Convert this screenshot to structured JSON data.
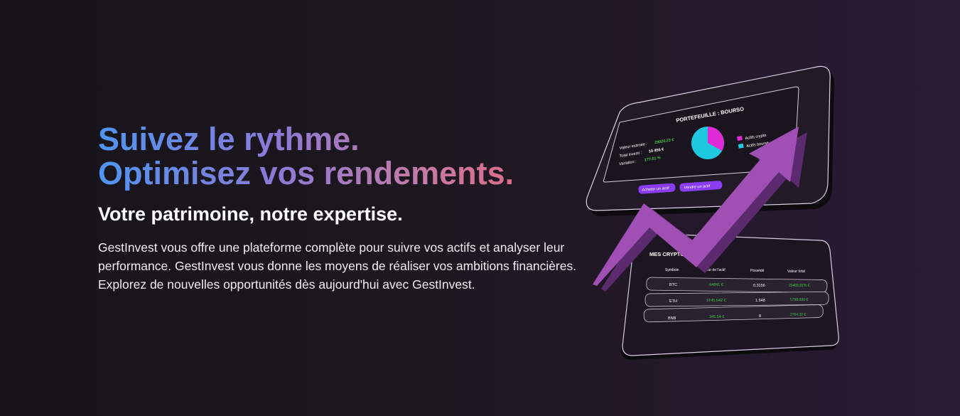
{
  "hero": {
    "headline_line1": "Suivez le rythme.",
    "headline_line2": "Optimisez vos rendements.",
    "subheading": "Votre patrimoine, notre expertise.",
    "description": "GestInvest vous offre une plateforme complète pour suivre vos actifs et analyser leur performance. GestInvest vous donne les moyens de réaliser vos ambitions financières. Explorez de nouvelles opportunités dès aujourd'hui avec GestInvest."
  },
  "portfolio_card": {
    "title": "PORTEFEUILLE : BOURSO",
    "estimated_label": "Valeur estimée :",
    "estimated_value": "29026.23 €",
    "invested_label": "Total investi :",
    "invested_value": "10 456 €",
    "variation_label": "Variation :",
    "variation_value": "177.61 %",
    "legend": [
      "Actifs crypto",
      "Actifs bourse"
    ],
    "buy_button": "Acheter un actif",
    "sell_button": "Vendre un actif",
    "colors": {
      "crypto": "#e02ad8",
      "bourse": "#1ec8e0",
      "green": "#3ec93e",
      "button": "#8a3cf0"
    }
  },
  "crypto_card": {
    "title": "MES CRYPTOS MONNAIES",
    "columns": [
      "Symbole",
      "Valeur de l'actif",
      "Possédé",
      "Valeur total"
    ],
    "rows": [
      {
        "symbol": "BTC",
        "value": "64841 €",
        "owned": "0.3156",
        "total": "20465.81% €"
      },
      {
        "symbol": "ETH",
        "value": "3745.542 €",
        "owned": "1.548",
        "total": "5798.099 €"
      },
      {
        "symbol": "BNB",
        "value": "345.54 €",
        "owned": "8",
        "total": "2764.32 €"
      }
    ]
  },
  "accent_colors": {
    "arrow": "#a04fb5",
    "arrow_shadow": "#5c2a6e"
  }
}
